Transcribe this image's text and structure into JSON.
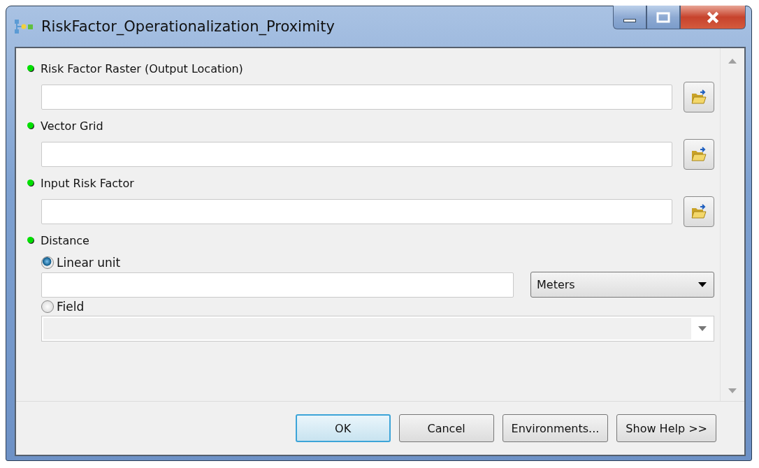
{
  "window": {
    "title": "RiskFactor_Operationalization_Proximity"
  },
  "parameters": [
    {
      "label": "Risk Factor Raster (Output Location)",
      "required": true
    },
    {
      "label": "Vector Grid",
      "required": true
    },
    {
      "label": "Input Risk Factor",
      "required": true
    }
  ],
  "distance": {
    "label": "Distance",
    "required": true,
    "options": [
      {
        "label": "Linear unit",
        "selected": true,
        "kind": "linear"
      },
      {
        "label": "Field",
        "selected": false,
        "kind": "field"
      }
    ],
    "unit": "Meters"
  },
  "buttons": [
    {
      "label": "OK",
      "default": true
    },
    {
      "label": "Cancel",
      "default": false
    },
    {
      "label": "Environments...",
      "default": false
    },
    {
      "label": "Show Help >>",
      "default": false
    }
  ]
}
